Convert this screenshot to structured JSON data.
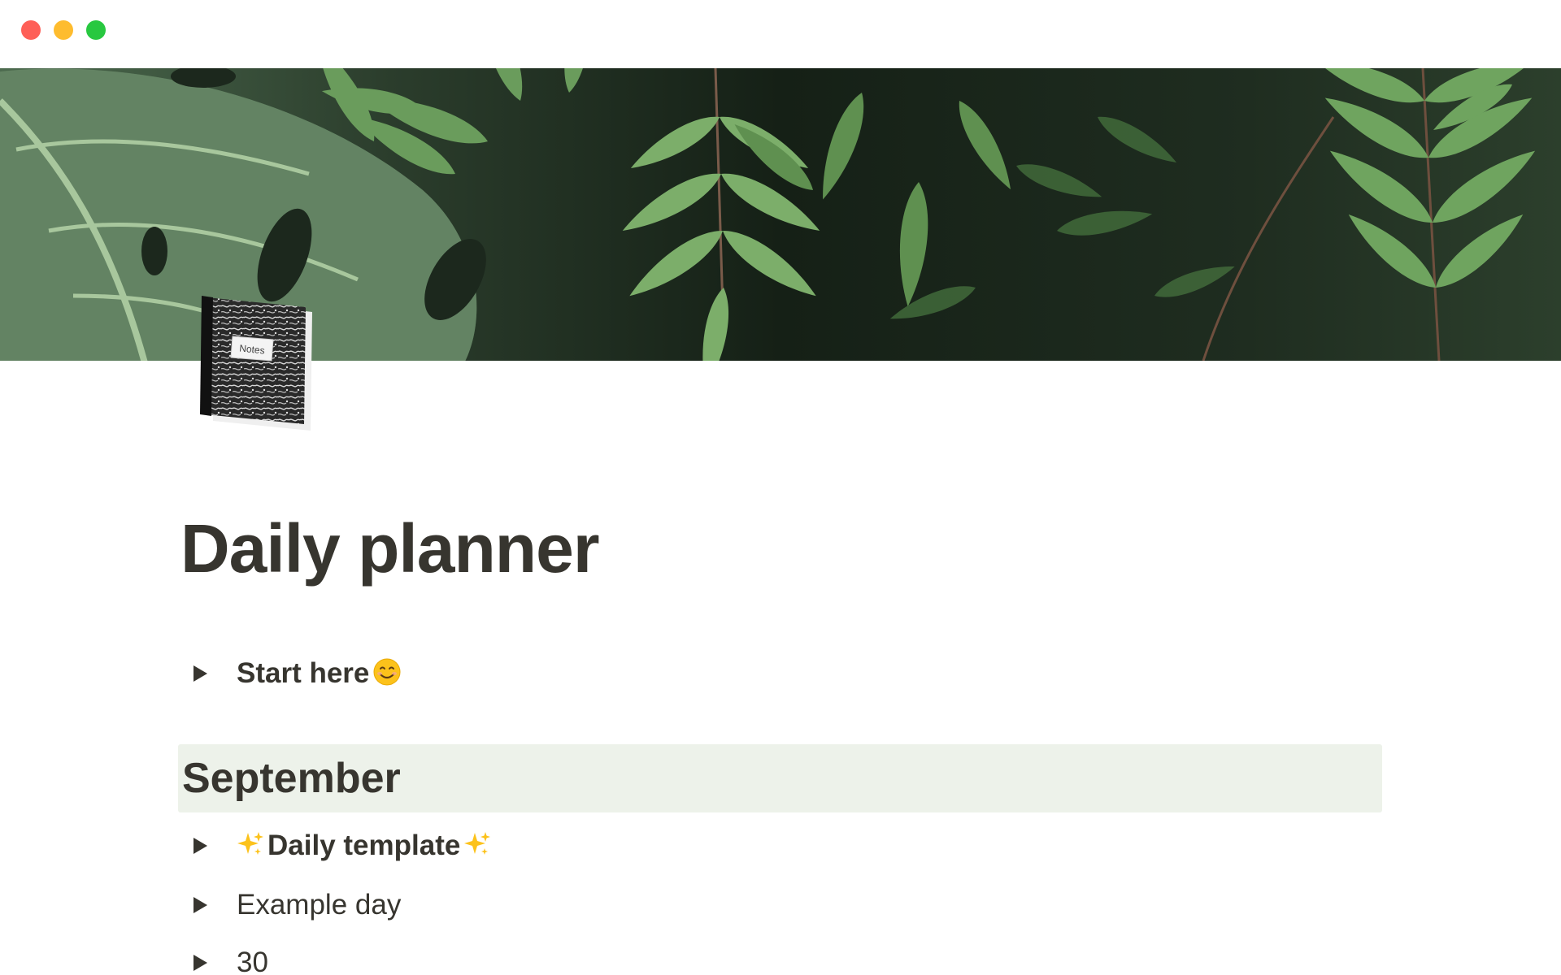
{
  "window": {
    "controls": [
      "close",
      "minimize",
      "maximize"
    ],
    "colors": {
      "close": "#fe5f57",
      "minimize": "#febc2e",
      "maximize": "#28c840"
    }
  },
  "cover": {
    "icon": "fern-leaves-cover-image"
  },
  "page": {
    "icon": "composition-notebook-icon",
    "icon_text": "Notes",
    "title": "Daily planner"
  },
  "toggles": {
    "start": {
      "label": "Start here",
      "emoji": "smiling-face-icon"
    },
    "daily_template": {
      "label": "Daily template",
      "emoji": "sparkles-icon"
    },
    "example_day": {
      "label": "Example day"
    },
    "day_30": {
      "label": "30"
    }
  },
  "sections": {
    "september": {
      "heading": "September",
      "background": "#edf2ea"
    }
  },
  "colors": {
    "text": "#37352f",
    "background": "#ffffff"
  }
}
